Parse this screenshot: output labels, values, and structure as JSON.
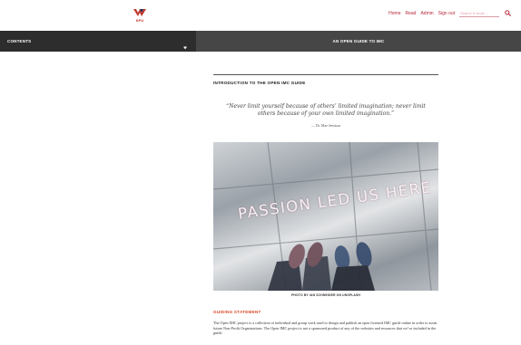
{
  "header": {
    "logo_text": "KPU",
    "nav": [
      "Home",
      "Read",
      "Admin",
      "Sign out"
    ],
    "search_placeholder": "Search in book ..."
  },
  "toolbar": {
    "contents_label": "CONTENTS",
    "book_title": "AN OPEN GUIDE TO IMC"
  },
  "main": {
    "section_heading": "INTRODUCTION TO THE OPEN IMC GUIDE",
    "quote": "“Never limit yourself because of others’ limited imagination; never limit others because of your own limited imagination.”",
    "attribution": "— Dr. Mae Jemison",
    "photo_text": "PASSION LED US HERE",
    "photo_caption": "PHOTO BY IAN SCHNEIDER ON UNSPLASH",
    "guiding_heading": "GUIDING STATEMENT",
    "guiding_body": "The Open IMC project is a collection of individual and group work used to design and publish an open licensed IMC guide online in order to assist future Non-Profit Organizations. The Open IMC project is not a sponsored product of any of the websites and resources that we’ve included in the guide."
  },
  "colors": {
    "brand": "#b5283a",
    "dark_bar": "#2d2d2d",
    "title_bar": "#464646",
    "accent_heading": "#d64b2a"
  },
  "icons": {
    "logo": "kpu-logo-icon",
    "search": "search-icon",
    "caret": "caret-down-icon"
  }
}
